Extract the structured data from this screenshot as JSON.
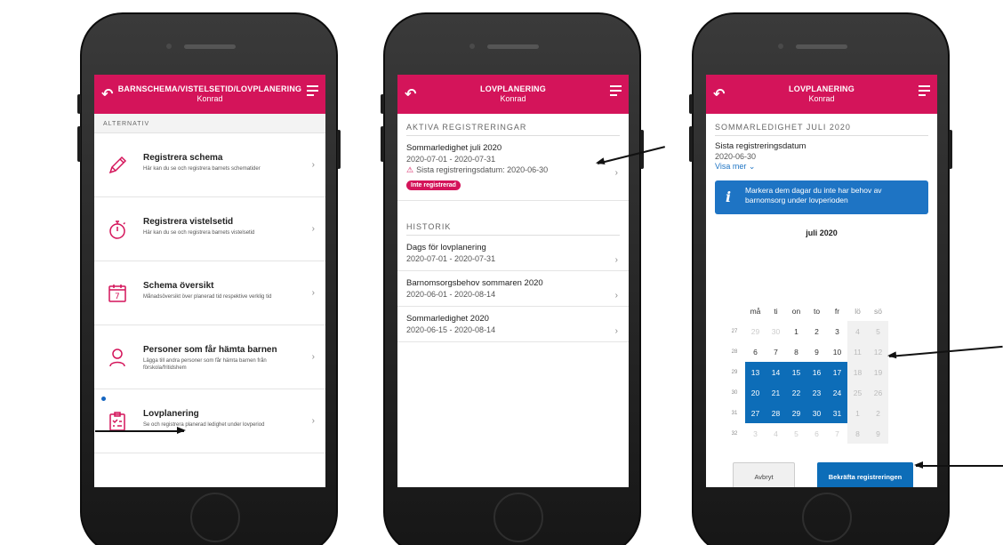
{
  "screen1": {
    "title": "BARNSCHEMA/VISTELSETID/LOVPLANERING",
    "subtitle": "Konrad",
    "section": "ALTERNATIV",
    "options": [
      {
        "title": "Registrera schema",
        "desc": "Här kan du se och registrera barnets schematider",
        "icon": "pencil-icon"
      },
      {
        "title": "Registrera vistelsetid",
        "desc": "Här kan du se och registrera barnets vistelsetid",
        "icon": "stopwatch-icon"
      },
      {
        "title": "Schema översikt",
        "desc": "Månadsöversikt över planerad tid respektive verklig tid",
        "icon": "calendar-icon"
      },
      {
        "title": "Personer som får hämta barnen",
        "desc": "Lägga till andra personer som får hämta barnen från förskola/fritidshem",
        "icon": "person-icon"
      },
      {
        "title": "Lovplanering",
        "desc": "Se och registrera planerad ledighet under lovperiod",
        "icon": "clipboard-icon"
      }
    ]
  },
  "screen2": {
    "title": "LOVPLANERING",
    "subtitle": "Konrad",
    "active_label": "AKTIVA REGISTRERINGAR",
    "active": {
      "title": "Sommarledighet juli 2020",
      "dates": "2020-07-01 - 2020-07-31",
      "warning": "Sista registreringsdatum: 2020-06-30",
      "badge": "Inte registrerad"
    },
    "history_label": "HISTORIK",
    "history": [
      {
        "title": "Dags för lovplanering",
        "dates": "2020-07-01 - 2020-07-31"
      },
      {
        "title": "Barnomsorgsbehov sommaren 2020",
        "dates": "2020-06-01 - 2020-08-14"
      },
      {
        "title": "Sommarledighet 2020",
        "dates": "2020-06-15 - 2020-08-14"
      }
    ]
  },
  "screen3": {
    "title": "LOVPLANERING",
    "subtitle": "Konrad",
    "section": "SOMMARLEDIGHET JULI 2020",
    "deadline_label": "Sista registreringsdatum",
    "deadline_date": "2020-06-30",
    "show_more": "Visa mer",
    "info": "Markera dem dagar du inte har behov av barnomsorg under lovperioden",
    "month": "juli 2020",
    "weekdays": [
      "må",
      "ti",
      "on",
      "to",
      "fr",
      "lö",
      "sö"
    ],
    "weeks": [
      {
        "wk": "27",
        "days": [
          "29",
          "30",
          "1",
          "2",
          "3",
          "4",
          "5"
        ]
      },
      {
        "wk": "28",
        "days": [
          "6",
          "7",
          "8",
          "9",
          "10",
          "11",
          "12"
        ]
      },
      {
        "wk": "29",
        "days": [
          "13",
          "14",
          "15",
          "16",
          "17",
          "18",
          "19"
        ]
      },
      {
        "wk": "30",
        "days": [
          "20",
          "21",
          "22",
          "23",
          "24",
          "25",
          "26"
        ]
      },
      {
        "wk": "31",
        "days": [
          "27",
          "28",
          "29",
          "30",
          "31",
          "1",
          "2"
        ]
      },
      {
        "wk": "32",
        "days": [
          "3",
          "4",
          "5",
          "6",
          "7",
          "8",
          "9"
        ]
      }
    ],
    "selected_weeks": [
      "29",
      "30",
      "31"
    ],
    "cancel": "Avbryt",
    "confirm": "Bekräfta registreringen"
  },
  "colors": {
    "accent": "#d4145a",
    "primary": "#0d6db8"
  }
}
